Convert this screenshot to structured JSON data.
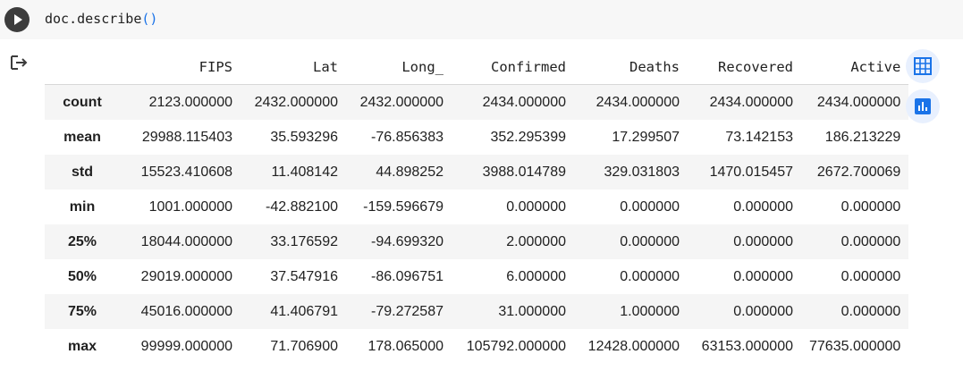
{
  "cell": {
    "code_prefix": "doc.describe",
    "code_parens": "()",
    "run_icon": "play-icon",
    "output_icon": "output-redirect-icon"
  },
  "table": {
    "columns": [
      "FIPS",
      "Lat",
      "Long_",
      "Confirmed",
      "Deaths",
      "Recovered",
      "Active"
    ],
    "rows": [
      {
        "label": "count",
        "values": [
          "2123.000000",
          "2432.000000",
          "2432.000000",
          "2434.000000",
          "2434.000000",
          "2434.000000",
          "2434.000000"
        ]
      },
      {
        "label": "mean",
        "values": [
          "29988.115403",
          "35.593296",
          "-76.856383",
          "352.295399",
          "17.299507",
          "73.142153",
          "186.213229"
        ]
      },
      {
        "label": "std",
        "values": [
          "15523.410608",
          "11.408142",
          "44.898252",
          "3988.014789",
          "329.031803",
          "1470.015457",
          "2672.700069"
        ]
      },
      {
        "label": "min",
        "values": [
          "1001.000000",
          "-42.882100",
          "-159.596679",
          "0.000000",
          "0.000000",
          "0.000000",
          "0.000000"
        ]
      },
      {
        "label": "25%",
        "values": [
          "18044.000000",
          "33.176592",
          "-94.699320",
          "2.000000",
          "0.000000",
          "0.000000",
          "0.000000"
        ]
      },
      {
        "label": "50%",
        "values": [
          "29019.000000",
          "37.547916",
          "-86.096751",
          "6.000000",
          "0.000000",
          "0.000000",
          "0.000000"
        ]
      },
      {
        "label": "75%",
        "values": [
          "45016.000000",
          "41.406791",
          "-79.272587",
          "31.000000",
          "1.000000",
          "0.000000",
          "0.000000"
        ]
      },
      {
        "label": "max",
        "values": [
          "99999.000000",
          "71.706900",
          "178.065000",
          "105792.000000",
          "12428.000000",
          "63153.000000",
          "77635.000000"
        ]
      }
    ]
  },
  "side_buttons": {
    "table_icon": "table-icon",
    "chart_icon": "bar-chart-icon",
    "accent": "#1a73e8",
    "background": "#e8f0fe"
  }
}
